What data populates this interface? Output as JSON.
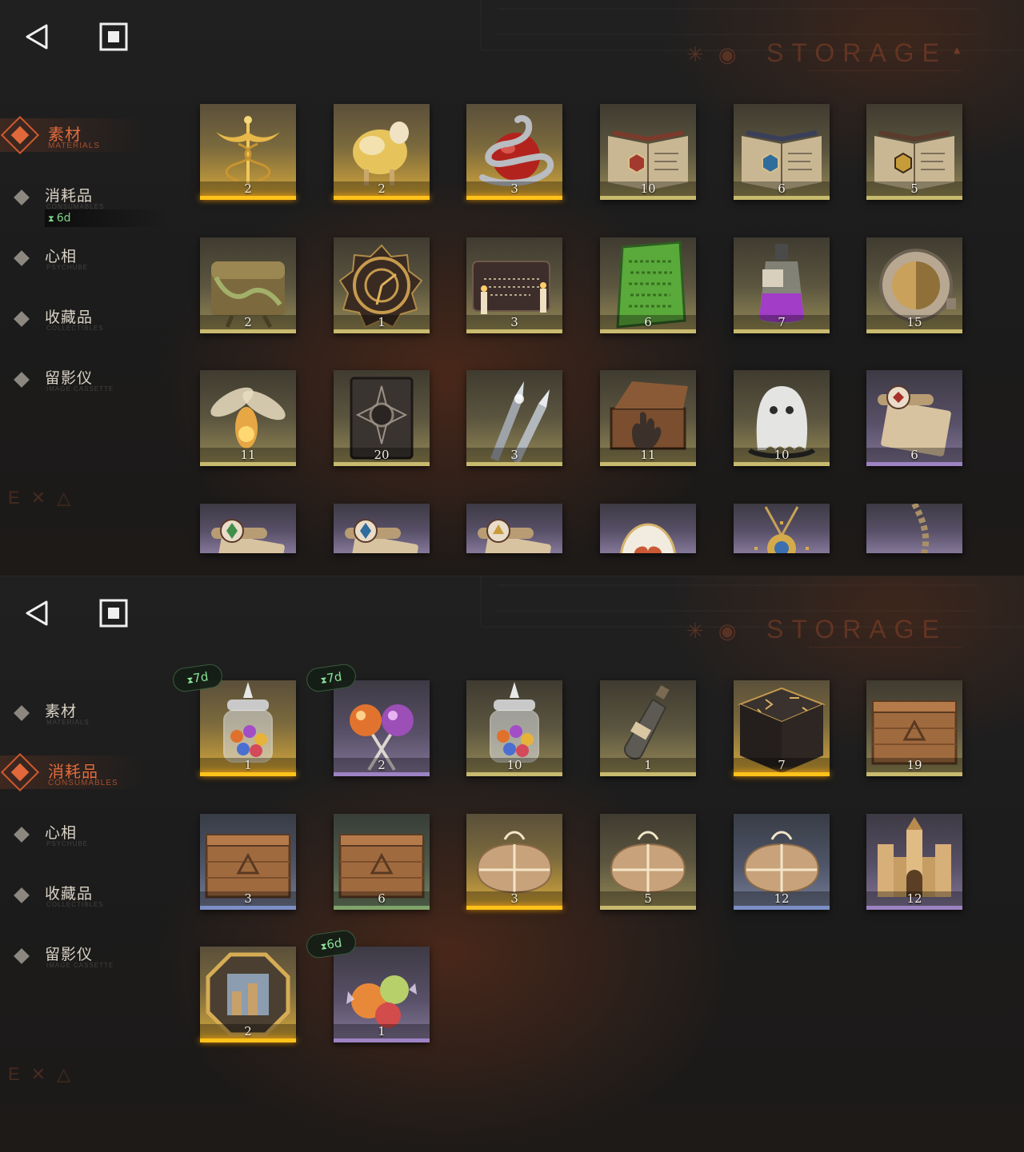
{
  "storage_title": "STORAGE",
  "panels": [
    {
      "nav": [
        {
          "label": "素材",
          "sub": "MATERIALS",
          "active": true
        },
        {
          "label": "消耗品",
          "sub": "CONSUMABLES",
          "active": false,
          "timer": "6d"
        },
        {
          "label": "心相",
          "sub": "PSYCHUBE",
          "active": false
        },
        {
          "label": "收藏品",
          "sub": "COLLECTIBLES",
          "active": false
        },
        {
          "label": "留影仪",
          "sub": "IMAGE CASSETTE",
          "active": false
        }
      ],
      "items": [
        {
          "name": "caduceus-icon",
          "qty": "2",
          "rarity": "gold"
        },
        {
          "name": "golden-sheep-icon",
          "qty": "2",
          "rarity": "gold"
        },
        {
          "name": "snake-apple-icon",
          "qty": "3",
          "rarity": "gold"
        },
        {
          "name": "open-book-red-icon",
          "qty": "10",
          "rarity": "khaki"
        },
        {
          "name": "open-book-blue-icon",
          "qty": "6",
          "rarity": "khaki"
        },
        {
          "name": "open-book-gold-icon",
          "qty": "5",
          "rarity": "khaki"
        },
        {
          "name": "mossy-chest-icon",
          "qty": "2",
          "rarity": "khaki"
        },
        {
          "name": "astrolabe-icon",
          "qty": "1",
          "rarity": "khaki"
        },
        {
          "name": "ouija-board-icon",
          "qty": "3",
          "rarity": "khaki"
        },
        {
          "name": "green-tablet-icon",
          "qty": "6",
          "rarity": "khaki"
        },
        {
          "name": "potion-bottle-icon",
          "qty": "7",
          "rarity": "khaki"
        },
        {
          "name": "pocket-watch-icon",
          "qty": "15",
          "rarity": "khaki"
        },
        {
          "name": "firefly-icon",
          "qty": "11",
          "rarity": "khaki"
        },
        {
          "name": "dark-tome-icon",
          "qty": "20",
          "rarity": "khaki"
        },
        {
          "name": "bullets-icon",
          "qty": "3",
          "rarity": "khaki"
        },
        {
          "name": "hand-box-icon",
          "qty": "11",
          "rarity": "khaki"
        },
        {
          "name": "ghost-icon",
          "qty": "10",
          "rarity": "khaki"
        },
        {
          "name": "scroll-red-icon",
          "qty": "6",
          "rarity": "purple"
        },
        {
          "name": "scroll-green-icon",
          "qty": "",
          "rarity": "purple"
        },
        {
          "name": "scroll-blue-icon",
          "qty": "",
          "rarity": "purple"
        },
        {
          "name": "scroll-gold-icon",
          "qty": "",
          "rarity": "purple"
        },
        {
          "name": "heart-egg-icon",
          "qty": "",
          "rarity": "purple"
        },
        {
          "name": "amulet-icon",
          "qty": "",
          "rarity": "purple"
        },
        {
          "name": "chain-pendant-icon",
          "qty": "",
          "rarity": "purple"
        }
      ]
    },
    {
      "nav": [
        {
          "label": "素材",
          "sub": "MATERIALS",
          "active": false
        },
        {
          "label": "消耗品",
          "sub": "CONSUMABLES",
          "active": true
        },
        {
          "label": "心相",
          "sub": "PSYCHUBE",
          "active": false
        },
        {
          "label": "收藏品",
          "sub": "COLLECTIBLES",
          "active": false
        },
        {
          "label": "留影仪",
          "sub": "IMAGE CASSETTE",
          "active": false
        }
      ],
      "items": [
        {
          "name": "candy-jar-icon",
          "qty": "1",
          "rarity": "gold",
          "timer": "7d"
        },
        {
          "name": "lollipops-icon",
          "qty": "2",
          "rarity": "purple",
          "timer": "7d"
        },
        {
          "name": "candy-jar-icon",
          "qty": "10",
          "rarity": "khaki"
        },
        {
          "name": "message-bottle-icon",
          "qty": "1",
          "rarity": "khaki"
        },
        {
          "name": "rune-cube-icon",
          "qty": "7",
          "rarity": "gold"
        },
        {
          "name": "wooden-crate-icon",
          "qty": "19",
          "rarity": "khaki"
        },
        {
          "name": "wooden-crate-icon",
          "qty": "3",
          "rarity": "blue"
        },
        {
          "name": "wooden-crate-icon",
          "qty": "6",
          "rarity": "green"
        },
        {
          "name": "parcel-icon",
          "qty": "3",
          "rarity": "gold"
        },
        {
          "name": "parcel-icon",
          "qty": "5",
          "rarity": "khaki"
        },
        {
          "name": "parcel-icon",
          "qty": "12",
          "rarity": "blue"
        },
        {
          "name": "castle-icon",
          "qty": "12",
          "rarity": "purple"
        },
        {
          "name": "octagon-medallion-icon",
          "qty": "2",
          "rarity": "gold"
        },
        {
          "name": "wrapped-candies-icon",
          "qty": "1",
          "rarity": "purple",
          "timer": "6d"
        }
      ]
    }
  ]
}
